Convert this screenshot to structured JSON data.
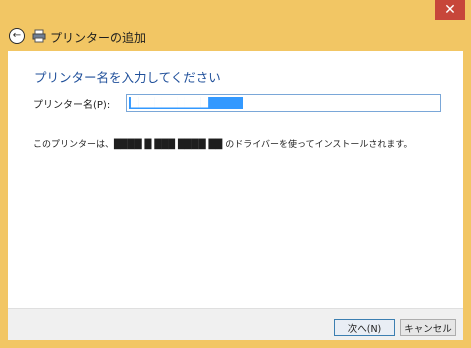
{
  "window": {
    "title": "プリンターの追加",
    "close_label": "✕"
  },
  "page": {
    "heading": "プリンター名を入力してください",
    "name_label": "プリンター名(P):",
    "name_value": "██████████",
    "driver_text": "このプリンターは、████ █ ███ ████ ██ のドライバーを使ってインストールされます。"
  },
  "footer": {
    "next_label": "次へ(N)",
    "cancel_label": "キャンセル"
  },
  "icons": {
    "back": "back-arrow-icon",
    "printer": "printer-icon"
  }
}
